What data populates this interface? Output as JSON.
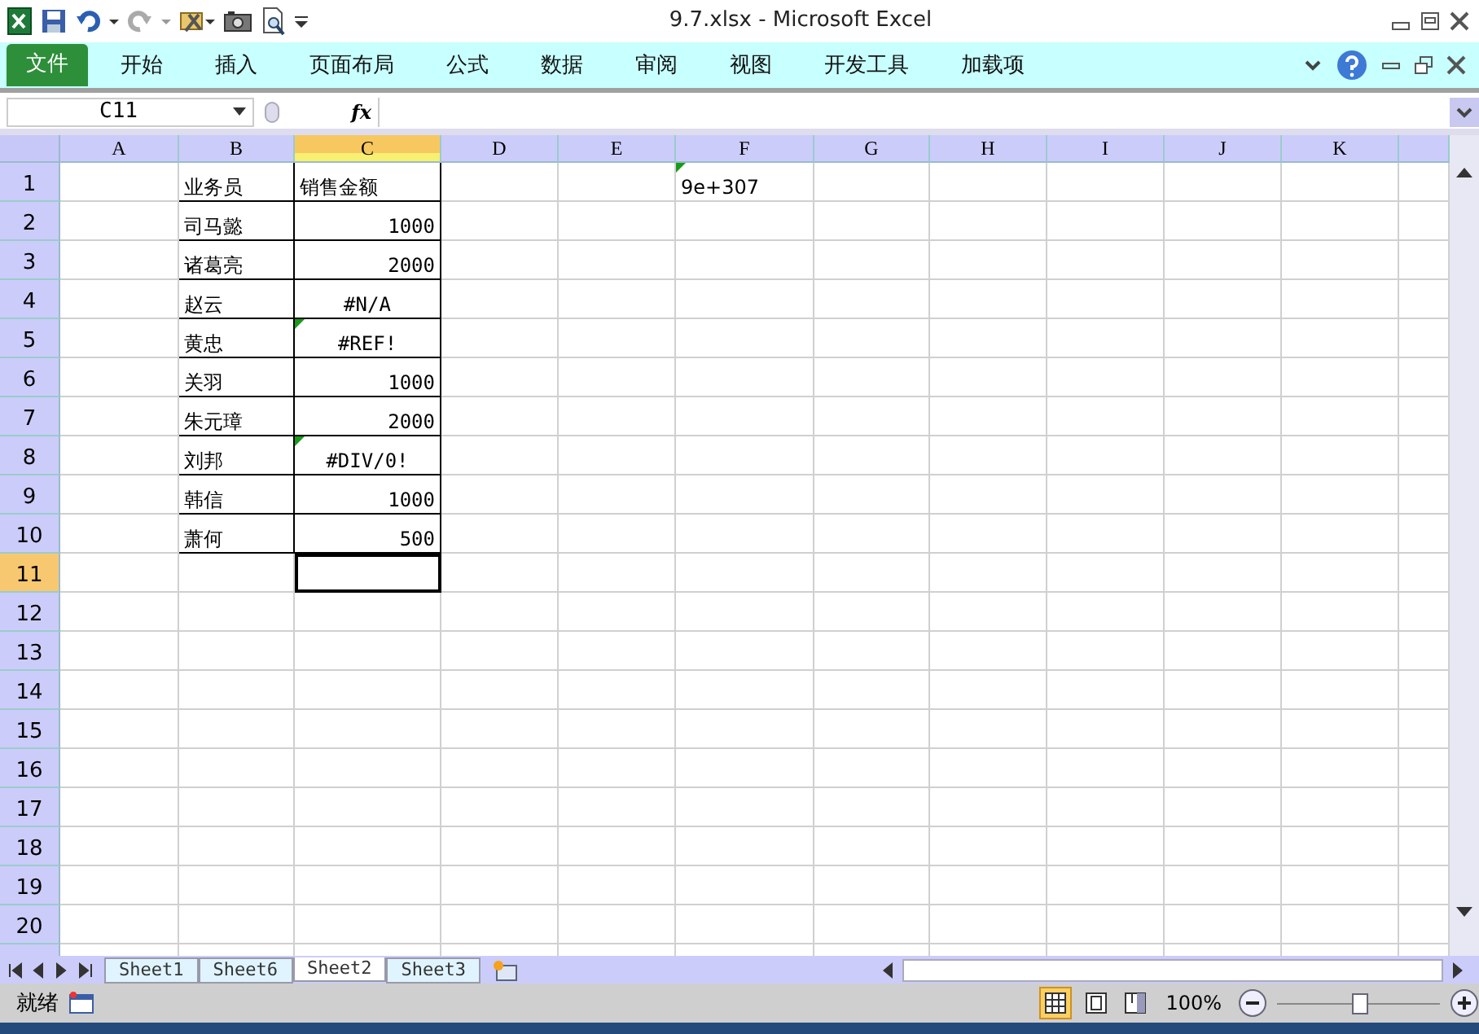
{
  "window": {
    "title": "9.7.xlsx  -  Microsoft Excel"
  },
  "ribbon_tabs": [
    {
      "label": "文件",
      "kind": "file"
    },
    {
      "label": "开始",
      "kind": "tab"
    },
    {
      "label": "插入",
      "kind": "tab"
    },
    {
      "label": "页面布局",
      "kind": "tab"
    },
    {
      "label": "公式",
      "kind": "tab"
    },
    {
      "label": "数据",
      "kind": "tab"
    },
    {
      "label": "审阅",
      "kind": "tab"
    },
    {
      "label": "视图",
      "kind": "tab"
    },
    {
      "label": "开发工具",
      "kind": "tab"
    },
    {
      "label": "加载项",
      "kind": "tab"
    }
  ],
  "formula_bar": {
    "name_box": "C11",
    "function_label": "fx"
  },
  "sheet": {
    "columns": [
      {
        "label": "A",
        "selected": false
      },
      {
        "label": "B",
        "selected": false
      },
      {
        "label": "C",
        "selected": true
      },
      {
        "label": "D",
        "selected": false
      },
      {
        "label": "E",
        "selected": false
      },
      {
        "label": "F",
        "selected": false
      },
      {
        "label": "G",
        "selected": false
      },
      {
        "label": "H",
        "selected": false
      },
      {
        "label": "I",
        "selected": false
      },
      {
        "label": "J",
        "selected": false
      },
      {
        "label": "K",
        "selected": false
      }
    ],
    "rows": [
      {
        "label": "1",
        "selected": false,
        "cells": {
          "B": {
            "text": "业务员",
            "kind": "text",
            "bordered": true,
            "error_flag": false
          },
          "C": {
            "text": "销售金额",
            "kind": "text",
            "bordered": true,
            "error_flag": false
          },
          "F": {
            "text": "9e+307",
            "kind": "text",
            "bordered": false,
            "error_flag": true
          }
        }
      },
      {
        "label": "2",
        "selected": false,
        "cells": {
          "B": {
            "text": "司马懿",
            "kind": "text",
            "bordered": true,
            "error_flag": false
          },
          "C": {
            "text": "1000",
            "kind": "number",
            "bordered": true,
            "error_flag": false
          }
        }
      },
      {
        "label": "3",
        "selected": false,
        "cells": {
          "B": {
            "text": "诸葛亮",
            "kind": "text",
            "bordered": true,
            "error_flag": false
          },
          "C": {
            "text": "2000",
            "kind": "number",
            "bordered": true,
            "error_flag": false
          }
        }
      },
      {
        "label": "4",
        "selected": false,
        "cells": {
          "B": {
            "text": "赵云",
            "kind": "text",
            "bordered": true,
            "error_flag": false
          },
          "C": {
            "text": "#N/A",
            "kind": "error",
            "bordered": true,
            "error_flag": false
          }
        }
      },
      {
        "label": "5",
        "selected": false,
        "cells": {
          "B": {
            "text": "黄忠",
            "kind": "text",
            "bordered": true,
            "error_flag": false
          },
          "C": {
            "text": "#REF!",
            "kind": "error",
            "bordered": true,
            "error_flag": true
          }
        }
      },
      {
        "label": "6",
        "selected": false,
        "cells": {
          "B": {
            "text": "关羽",
            "kind": "text",
            "bordered": true,
            "error_flag": false
          },
          "C": {
            "text": "1000",
            "kind": "number",
            "bordered": true,
            "error_flag": false
          }
        }
      },
      {
        "label": "7",
        "selected": false,
        "cells": {
          "B": {
            "text": "朱元璋",
            "kind": "text",
            "bordered": true,
            "error_flag": false
          },
          "C": {
            "text": "2000",
            "kind": "number",
            "bordered": true,
            "error_flag": false
          }
        }
      },
      {
        "label": "8",
        "selected": false,
        "cells": {
          "B": {
            "text": "刘邦",
            "kind": "text",
            "bordered": true,
            "error_flag": false
          },
          "C": {
            "text": "#DIV/0!",
            "kind": "error",
            "bordered": true,
            "error_flag": true
          }
        }
      },
      {
        "label": "9",
        "selected": false,
        "cells": {
          "B": {
            "text": "韩信",
            "kind": "text",
            "bordered": true,
            "error_flag": false
          },
          "C": {
            "text": "1000",
            "kind": "number",
            "bordered": true,
            "error_flag": false
          }
        }
      },
      {
        "label": "10",
        "selected": false,
        "cells": {
          "B": {
            "text": "萧何",
            "kind": "text",
            "bordered": true,
            "error_flag": false
          },
          "C": {
            "text": "500",
            "kind": "number",
            "bordered": true,
            "error_flag": false
          }
        }
      },
      {
        "label": "11",
        "selected": true,
        "cells": {}
      },
      {
        "label": "12",
        "selected": false,
        "cells": {}
      },
      {
        "label": "13",
        "selected": false,
        "cells": {}
      },
      {
        "label": "14",
        "selected": false,
        "cells": {}
      },
      {
        "label": "15",
        "selected": false,
        "cells": {}
      },
      {
        "label": "16",
        "selected": false,
        "cells": {}
      },
      {
        "label": "17",
        "selected": false,
        "cells": {}
      },
      {
        "label": "18",
        "selected": false,
        "cells": {}
      },
      {
        "label": "19",
        "selected": false,
        "cells": {}
      },
      {
        "label": "20",
        "selected": false,
        "cells": {}
      }
    ]
  },
  "sheet_tabs": [
    {
      "label": "Sheet1",
      "selected": false
    },
    {
      "label": "Sheet6",
      "selected": false
    },
    {
      "label": "Sheet2",
      "selected": true
    },
    {
      "label": "Sheet3",
      "selected": false
    }
  ],
  "status_bar": {
    "status": "就绪",
    "views": [
      {
        "selected": true
      },
      {
        "selected": false
      },
      {
        "selected": false
      }
    ],
    "zoom": "100%",
    "zoom_slider": {
      "level": 0.5
    }
  }
}
